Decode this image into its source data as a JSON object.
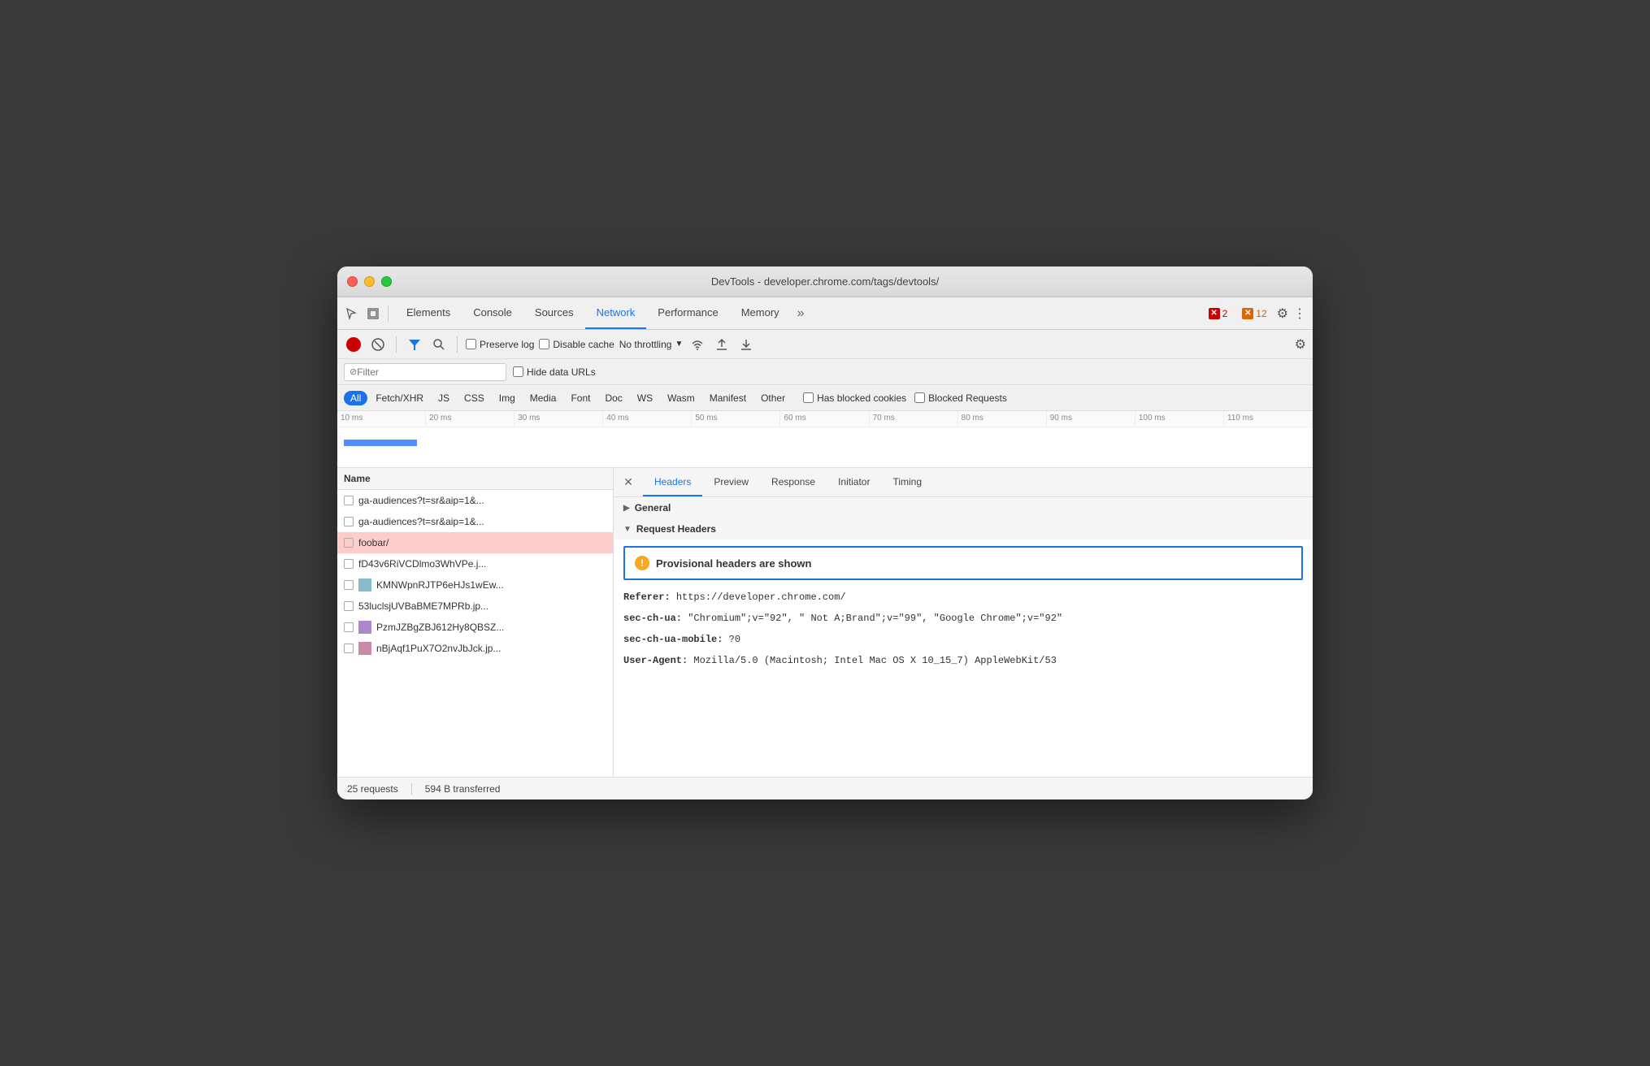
{
  "window": {
    "title": "DevTools - developer.chrome.com/tags/devtools/"
  },
  "tabs": {
    "items": [
      {
        "label": "Elements",
        "active": false
      },
      {
        "label": "Console",
        "active": false
      },
      {
        "label": "Sources",
        "active": false
      },
      {
        "label": "Network",
        "active": true
      },
      {
        "label": "Performance",
        "active": false
      },
      {
        "label": "Memory",
        "active": false
      }
    ],
    "more_label": "»",
    "error_count": "2",
    "warning_count": "12"
  },
  "toolbar": {
    "preserve_log_label": "Preserve log",
    "disable_cache_label": "Disable cache",
    "no_throttling_label": "No throttling"
  },
  "filter": {
    "placeholder": "Filter",
    "hide_urls_label": "Hide data URLs"
  },
  "type_filters": {
    "items": [
      "All",
      "Fetch/XHR",
      "JS",
      "CSS",
      "Img",
      "Media",
      "Font",
      "Doc",
      "WS",
      "Wasm",
      "Manifest",
      "Other"
    ],
    "active": "All",
    "has_blocked_cookies_label": "Has blocked cookies",
    "blocked_requests_label": "Blocked Requests"
  },
  "timeline": {
    "ticks": [
      "10 ms",
      "20 ms",
      "30 ms",
      "40 ms",
      "50 ms",
      "60 ms",
      "70 ms",
      "80 ms",
      "90 ms",
      "100 ms",
      "110 ms"
    ]
  },
  "file_list": {
    "header": "Name",
    "items": [
      {
        "name": "ga-audiences?t=sr&aip=1&...",
        "selected": false,
        "has_thumb": false
      },
      {
        "name": "ga-audiences?t=sr&aip=1&...",
        "selected": false,
        "has_thumb": false
      },
      {
        "name": "foobar/",
        "selected": true,
        "has_thumb": false
      },
      {
        "name": "fD43v6RiVCDlmo3WhVPe.j...",
        "selected": false,
        "has_thumb": false
      },
      {
        "name": "KMNWpnRJTP6eHJs1wEw...",
        "selected": false,
        "has_thumb": true
      },
      {
        "name": "53luclsjUVBaBME7MPRb.jp...",
        "selected": false,
        "has_thumb": false
      },
      {
        "name": "PzmJZBgZBJ612Hy8QBSZ...",
        "selected": false,
        "has_thumb": true
      },
      {
        "name": "nBjAqf1PuX7O2nvJbJck.jp...",
        "selected": false,
        "has_thumb": true
      }
    ]
  },
  "detail_tabs": {
    "items": [
      "Headers",
      "Preview",
      "Response",
      "Initiator",
      "Timing"
    ],
    "active": "Headers"
  },
  "headers_panel": {
    "general_section": "General",
    "request_headers_title": "Request Headers",
    "provisional_warning": "Provisional headers are shown",
    "headers": [
      {
        "key": "Referer:",
        "value": "https://developer.chrome.com/"
      },
      {
        "key": "sec-ch-ua:",
        "value": "\"Chromium\";v=\"92\", \" Not A;Brand\";v=\"99\", \"Google Chrome\";v=\"92\""
      },
      {
        "key": "sec-ch-ua-mobile:",
        "value": "?0"
      },
      {
        "key": "User-Agent:",
        "value": "Mozilla/5.0 (Macintosh; Intel Mac OS X 10_15_7) AppleWebKit/53"
      }
    ]
  },
  "status_bar": {
    "requests": "25 requests",
    "transferred": "594 B transferred"
  },
  "icons": {
    "cursor": "↖",
    "layers": "⧉",
    "filter": "⫸",
    "search": "🔍",
    "record_stop": "⬤",
    "clear": "🚫",
    "wifi": "📶",
    "upload": "⬆",
    "download": "⬇",
    "settings": "⚙",
    "warning": "!"
  }
}
